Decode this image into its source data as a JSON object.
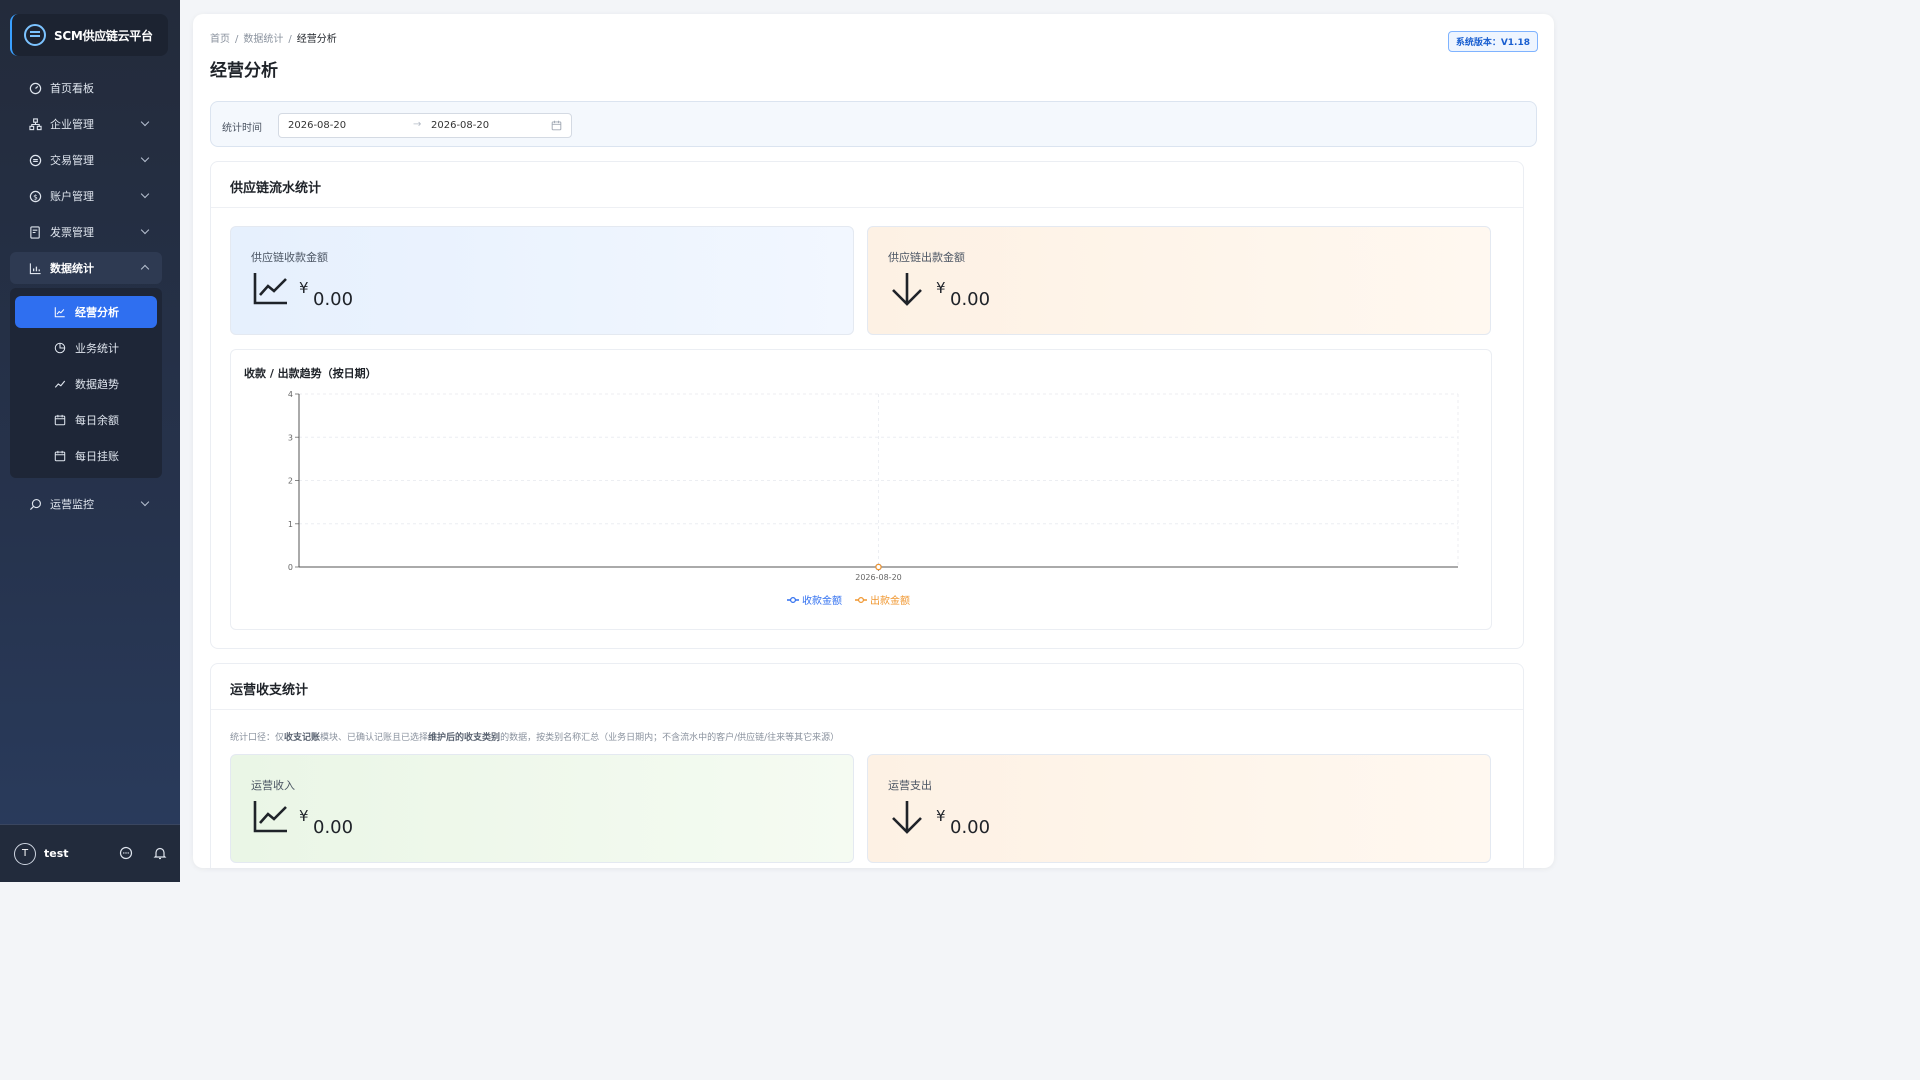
{
  "brand": {
    "name": "SCM供应链云平台"
  },
  "sidebar": {
    "items": [
      {
        "label": "首页看板",
        "icon": "dashboard-icon"
      },
      {
        "label": "企业管理",
        "icon": "org-icon"
      },
      {
        "label": "交易管理",
        "icon": "exchange-icon"
      },
      {
        "label": "账户管理",
        "icon": "dollar-icon"
      },
      {
        "label": "发票管理",
        "icon": "invoice-icon"
      },
      {
        "label": "数据统计",
        "icon": "bar-chart-icon"
      },
      {
        "label": "运营监控",
        "icon": "monitor-icon"
      }
    ],
    "sub_items": [
      {
        "label": "经营分析",
        "icon": "line-chart-icon"
      },
      {
        "label": "业务统计",
        "icon": "pie-chart-icon"
      },
      {
        "label": "数据趋势",
        "icon": "trend-icon"
      },
      {
        "label": "每日余额",
        "icon": "calendar-icon"
      },
      {
        "label": "每日挂账",
        "icon": "calendar-icon"
      }
    ]
  },
  "user": {
    "avatar_initial": "T",
    "name": "test"
  },
  "breadcrumb": [
    "首页",
    "数据统计",
    "经营分析"
  ],
  "page_title": "经营分析",
  "version": "系统版本：V1.18",
  "filter": {
    "label": "统计时间",
    "start": "2026-08-20",
    "end": "2026-08-20",
    "separator": "→"
  },
  "supply_section": {
    "title": "供应链流水统计",
    "income": {
      "label": "供应链收款金额",
      "currency": "¥",
      "amount": "0.00"
    },
    "expense": {
      "label": "供应链出款金额",
      "currency": "¥",
      "amount": "0.00"
    },
    "chart_title": "收款 / 出款趋势（按日期）"
  },
  "chart_data": {
    "type": "line",
    "title": "收款 / 出款趋势（按日期）",
    "x": [
      "2026-08-20"
    ],
    "ylim": [
      0,
      4
    ],
    "yticks": [
      0,
      1,
      2,
      3,
      4
    ],
    "grid": true,
    "legend_position": "bottom",
    "series": [
      {
        "name": "收款金额",
        "values": [
          0
        ],
        "color": "#2f6ff0"
      },
      {
        "name": "出款金额",
        "values": [
          0
        ],
        "color": "#f0962e"
      }
    ]
  },
  "ops_section": {
    "title": "运营收支统计",
    "note_parts": [
      "统计口径：仅",
      "收支记账",
      "模块、已确认记账且已选择",
      "维护后的收支类别",
      "的数据，按类别名称汇总（业务日期内；不含流水中的客户/供应链/往来等其它来源）"
    ],
    "income": {
      "label": "运营收入",
      "currency": "¥",
      "amount": "0.00"
    },
    "expense": {
      "label": "运营支出",
      "currency": "¥",
      "amount": "0.00"
    }
  }
}
